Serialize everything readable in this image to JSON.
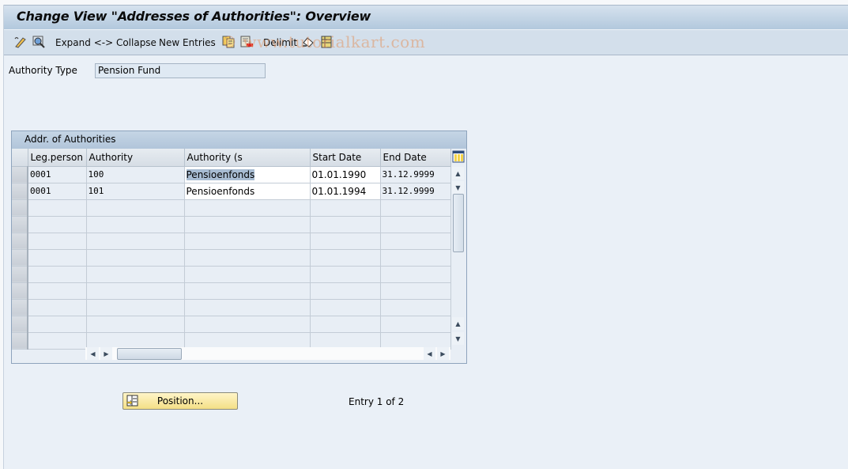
{
  "window": {
    "title": "Change View \"Addresses of Authorities\": Overview"
  },
  "toolbar": {
    "items": [
      {
        "icon": "display-change-icon"
      },
      {
        "icon": "find-icon"
      },
      {
        "label": "Expand <-> Collapse"
      },
      {
        "label": "New Entries"
      },
      {
        "icon": "copy-as-icon"
      },
      {
        "icon": "delete-icon"
      },
      {
        "label": "Delimit"
      },
      {
        "icon": "undo-change-icon"
      },
      {
        "icon": "select-all-icon"
      }
    ],
    "watermark": "© www.tutorialkart.com"
  },
  "header": {
    "authority_type_label": "Authority Type",
    "authority_type_value": "Pension Fund"
  },
  "table": {
    "title": "Addr. of Authorities",
    "columns": [
      "Leg.person",
      "Authority",
      "Authority (s",
      "Start Date",
      "End Date"
    ],
    "rows": [
      [
        "0001",
        "100",
        "Pensioenfonds",
        "01.01.1990",
        "31.12.9999"
      ],
      [
        "0001",
        "101",
        "Pensioenfonds",
        "01.01.1994",
        "31.12.9999"
      ],
      [
        "",
        "",
        "",
        "",
        ""
      ],
      [
        "",
        "",
        "",
        "",
        ""
      ],
      [
        "",
        "",
        "",
        "",
        ""
      ],
      [
        "",
        "",
        "",
        "",
        ""
      ],
      [
        "",
        "",
        "",
        "",
        ""
      ],
      [
        "",
        "",
        "",
        "",
        ""
      ],
      [
        "",
        "",
        "",
        "",
        ""
      ],
      [
        "",
        "",
        "",
        "",
        ""
      ],
      [
        "",
        "",
        "",
        "",
        ""
      ]
    ],
    "selected_cell": "Pensioenfonds"
  },
  "footer": {
    "position_button": "Position...",
    "entry_status": "Entry 1 of 2"
  }
}
